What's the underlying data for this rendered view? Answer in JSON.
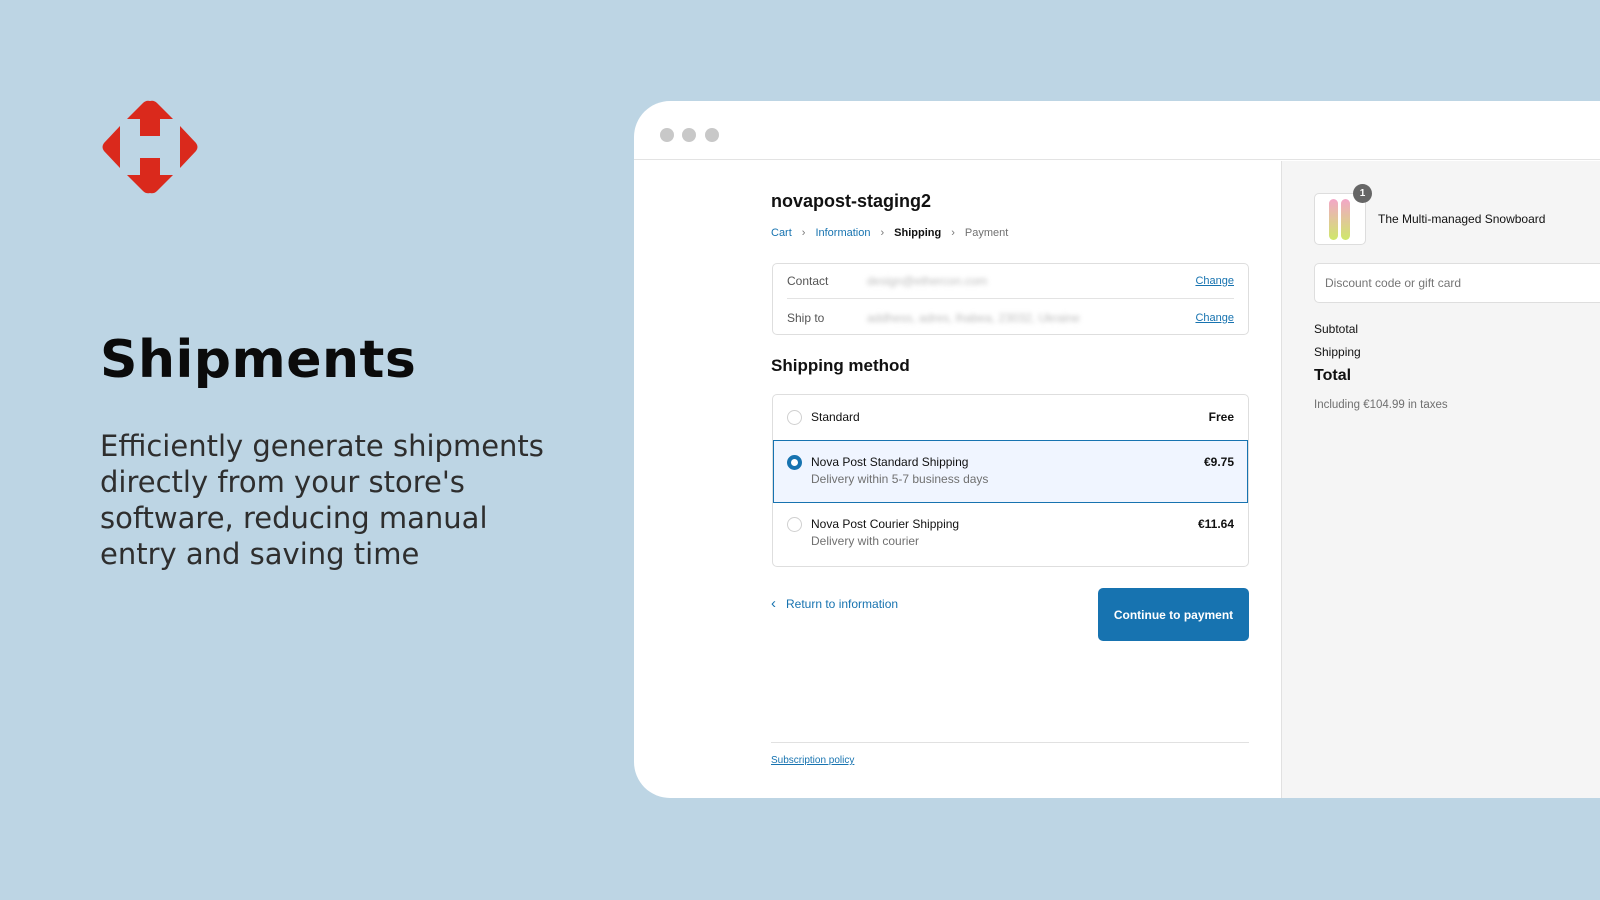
{
  "brand": {
    "logo": "nova-post-logo",
    "color": "#da291c"
  },
  "hero": {
    "title": "Shipments",
    "description": "Efficiently generate shipments directly from your store's software, reducing manual entry and saving time"
  },
  "checkout": {
    "store_name": "novapost-staging2",
    "breadcrumb": [
      {
        "label": "Cart"
      },
      {
        "label": "Information"
      },
      {
        "label": "Shipping"
      },
      {
        "label": "Payment"
      }
    ],
    "review": [
      {
        "label": "Contact",
        "value": "design@ethercon.com",
        "action": "Change"
      },
      {
        "label": "Ship to",
        "value": "addhess, adres, lhabea, 23032, Ukraine",
        "action": "Change"
      }
    ],
    "shipping_heading": "Shipping method",
    "methods": [
      {
        "name": "Standard",
        "description": "",
        "price": "Free",
        "selected": false
      },
      {
        "name": "Nova Post Standard Shipping",
        "description": "Delivery within 5-7 business days",
        "price": "€9.75",
        "selected": true
      },
      {
        "name": "Nova Post Courier Shipping",
        "description": "Delivery with courier",
        "price": "€11.64",
        "selected": false
      }
    ],
    "return_label": "Return to information",
    "continue_label": "Continue to payment",
    "subscription_policy": "Subscription policy",
    "accent": "#1773b0"
  },
  "summary": {
    "product_name": "The Multi-managed Snowboard",
    "quantity": "1",
    "discount_placeholder": "Discount code or gift card",
    "subtotal_label": "Subtotal",
    "shipping_label": "Shipping",
    "total_label": "Total",
    "taxes_note": "Including €104.99 in taxes"
  }
}
